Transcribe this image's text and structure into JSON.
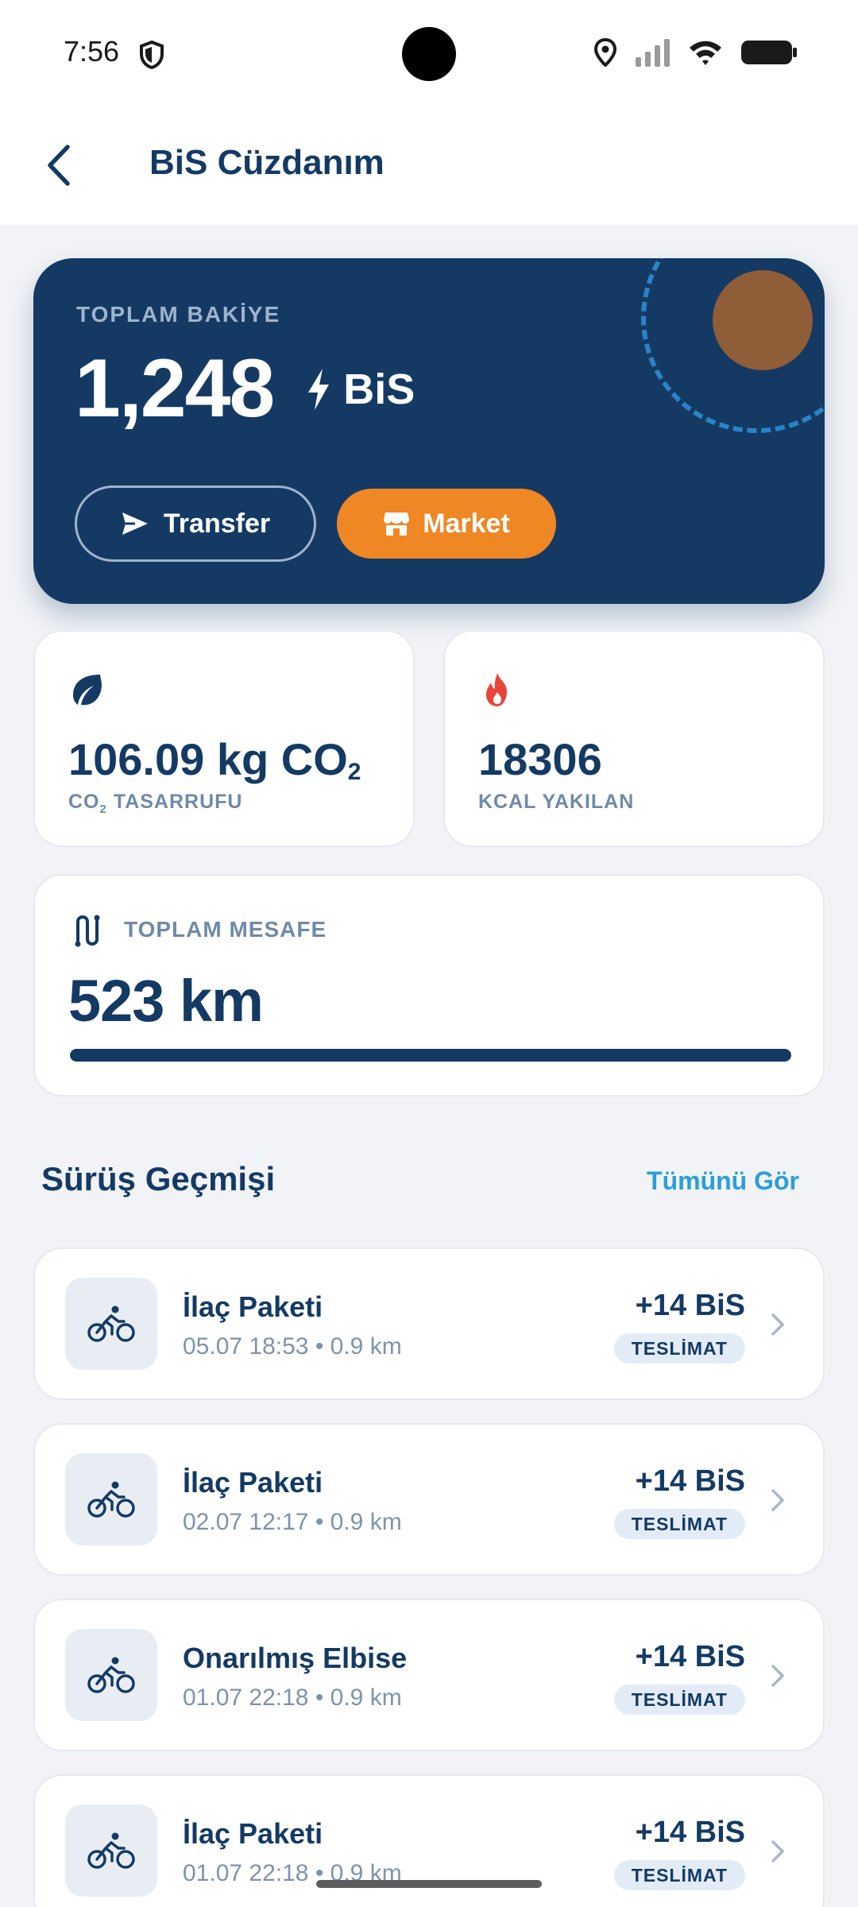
{
  "status_bar": {
    "time": "7:56"
  },
  "header": {
    "title": "BiS Cüzdanım"
  },
  "balance": {
    "label": "TOPLAM BAKİYE",
    "value": "1,248",
    "unit": "BiS",
    "transfer_label": "Transfer",
    "market_label": "Market"
  },
  "stats": {
    "co2": {
      "value": "106.09 kg CO",
      "value_sub": "2",
      "label_prefix": "CO",
      "label_sub": "2",
      "label_suffix": " TASARRUFU"
    },
    "kcal": {
      "value": "18306",
      "label": "KCAL YAKILAN"
    }
  },
  "distance": {
    "label": "TOPLAM MESAFE",
    "value": "523 km",
    "progress": 1.0
  },
  "history": {
    "title": "Sürüş Geçmişi",
    "see_all": "Tümünü Gör",
    "rides": [
      {
        "title": "İlaç Paketi",
        "meta": "05.07 18:53 • 0.9 km",
        "amount": "+14 BiS",
        "badge": "TESLİMAT"
      },
      {
        "title": "İlaç Paketi",
        "meta": "02.07 12:17 • 0.9 km",
        "amount": "+14 BiS",
        "badge": "TESLİMAT"
      },
      {
        "title": "Onarılmış Elbise",
        "meta": "01.07 22:18 • 0.9 km",
        "amount": "+14 BiS",
        "badge": "TESLİMAT"
      },
      {
        "title": "İlaç Paketi",
        "meta": "01.07 22:18 • 0.9 km",
        "amount": "+14 BiS",
        "badge": "TESLİMAT"
      }
    ]
  },
  "colors": {
    "primary": "#143a64",
    "accent_orange": "#ef8724",
    "link_blue": "#2a9fd6",
    "muted": "#6f8aa8",
    "flame_red": "#e8443a"
  },
  "icons": {
    "status": [
      "shield-icon",
      "location-icon",
      "signal-icon",
      "wifi-icon",
      "battery-icon"
    ],
    "header": "back-arrow-icon",
    "balance_unit": "lightning-icon",
    "transfer": "send-icon",
    "market": "store-icon",
    "co2": "leaf-icon",
    "kcal": "flame-icon",
    "distance": "route-icon",
    "ride": "bicycle-icon",
    "ride_action": "chevron-right-icon"
  }
}
